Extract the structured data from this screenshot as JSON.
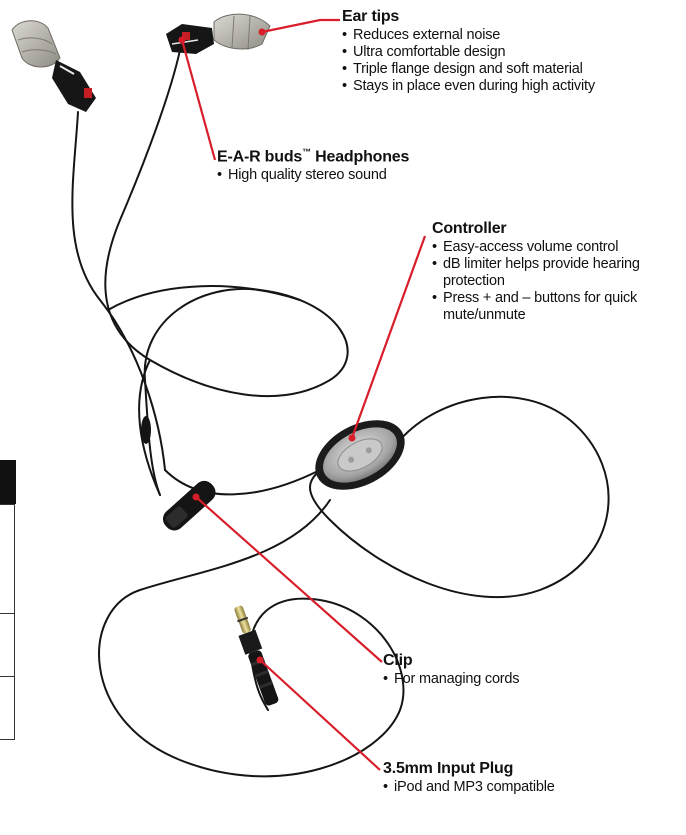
{
  "colors": {
    "callout_line": "#d81e2a",
    "cord": "#151515",
    "ear_tip": "#b9b6ae",
    "controller_body": "#a9a9a9",
    "plug_metal": "#c8b46a"
  },
  "icons": [
    "ear-tip-icon",
    "earbud-icon",
    "controller-icon",
    "clip-icon",
    "plug-icon"
  ],
  "callouts": {
    "ear_tips": {
      "title": "Ear tips",
      "bullets": [
        "Reduces external noise",
        "Ultra comfortable design",
        "Triple flange design and soft material",
        "Stays in place even during high activity"
      ]
    },
    "headphones": {
      "title": "E-A-R buds",
      "trademark": "™",
      "title_suffix": " Headphones",
      "bullets": [
        "High quality stereo sound"
      ]
    },
    "controller": {
      "title": "Controller",
      "bullets": [
        "Easy-access volume control",
        "dB limiter helps provide hearing protection",
        "Press + and – buttons for quick mute/unmute"
      ]
    },
    "clip": {
      "title": "Clip",
      "bullets": [
        "For managing cords"
      ]
    },
    "plug": {
      "title": "3.5mm Input Plug",
      "bullets": [
        "iPod and MP3 compatible"
      ]
    }
  }
}
